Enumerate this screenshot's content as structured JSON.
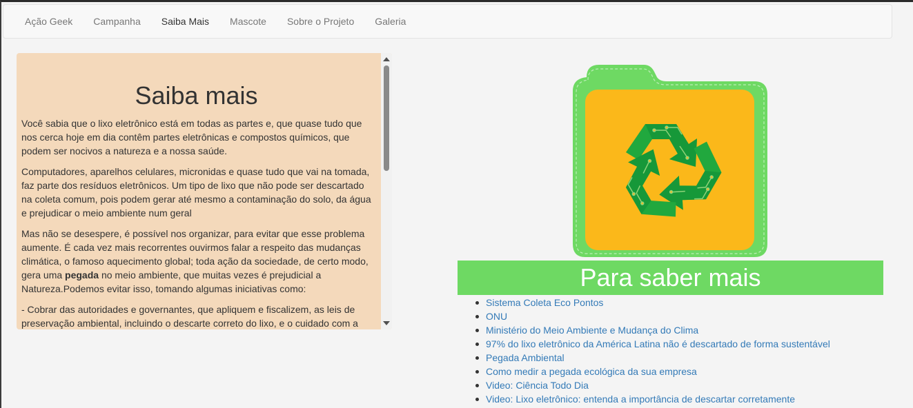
{
  "nav": {
    "items": [
      {
        "label": "Ação Geek"
      },
      {
        "label": "Campanha"
      },
      {
        "label": "Saiba Mais",
        "active": true
      },
      {
        "label": "Mascote"
      },
      {
        "label": "Sobre o Projeto"
      },
      {
        "label": "Galeria"
      }
    ]
  },
  "article": {
    "title": "Saiba mais",
    "p1": "Você sabia que o lixo eletrônico está em todas as partes e, que quase tudo que nos cerca hoje em dia contêm partes eletrônicas e compostos químicos, que podem ser nocivos a natureza e a nossa saúde.",
    "p2": "Computadores, aparelhos celulares, micronidas e quase tudo que vai na tomada, faz parte dos resíduos eletrônicos. Um tipo de lixo que não pode ser descartado na coleta comum, pois podem gerar até mesmo a contaminação do solo, da água e prejudicar o meio ambiente num geral",
    "p3_before": "Mas não se desespere, é possível nos organizar, para evitar que esse problema aumente. É cada vez mais recorrentes ouvirmos falar a respeito das mudanças climática, o famoso aquecimento global; toda ação da sociedade, de certo modo, gera uma ",
    "p3_bold": "pegada",
    "p3_after": " no meio ambiente, que muitas vezes é prejudicial a Natureza.Podemos evitar isso, tomando algumas iniciativas como:",
    "p4": "- Cobrar das autoridades e governantes, que apliquem e fiscalizem, as leis de preservação ambiental, incluindo o descarte correto do lixo, e o cuidado com a"
  },
  "image": {
    "icon": "recycle-electronics-folder-icon"
  },
  "banner": {
    "title": "Para saber mais"
  },
  "links": [
    "Sistema Coleta Eco Pontos",
    "ONU",
    "Ministério do Meio Ambiente e Mudança do Clima",
    "97% do lixo eletrônico da América Latina não é descartado de forma sustentável",
    "Pegada Ambiental",
    "Como medir a pegada ecológica da sua empresa",
    "Video: Ciência Todo Dia",
    "Video: Lixo eletrônico: entenda a importância de descartar corretamente"
  ],
  "colors": {
    "article_bg": "#f4d9bb",
    "banner_bg": "#6ed963",
    "link": "#337ab7",
    "folder_green": "#6ed963",
    "folder_yellow": "#fbb81a"
  }
}
